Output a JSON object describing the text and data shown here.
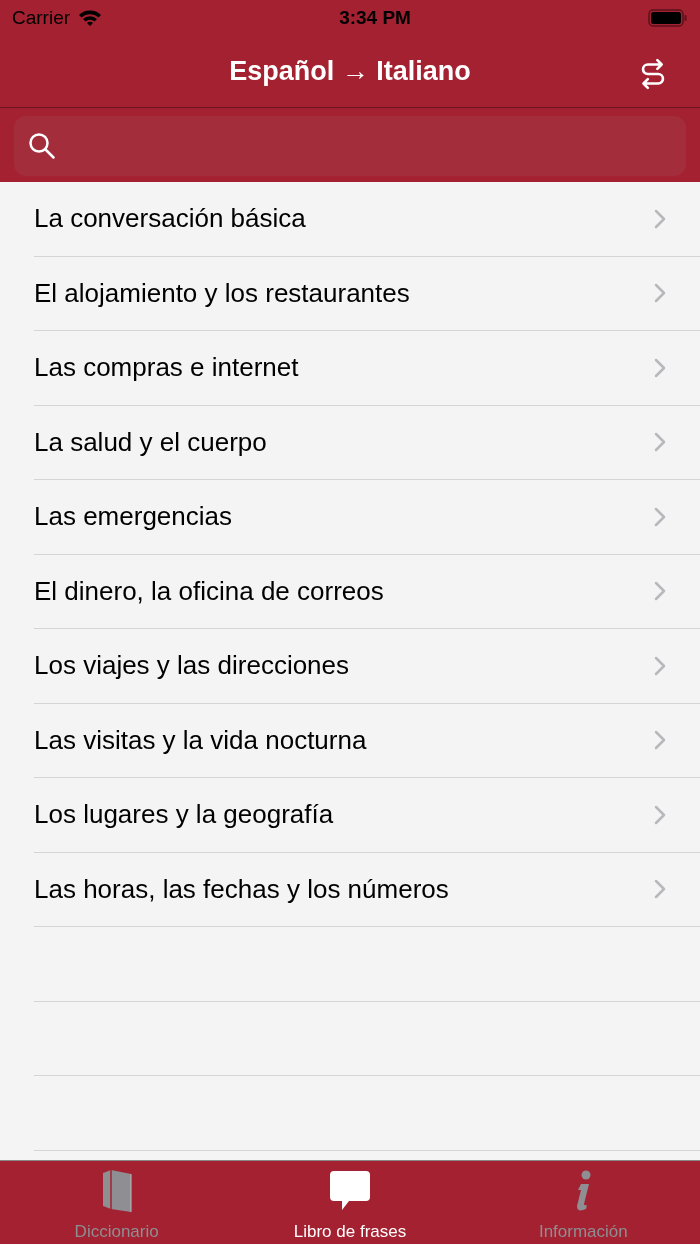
{
  "status_bar": {
    "carrier": "Carrier",
    "time": "3:34 PM"
  },
  "nav": {
    "title": "Español → Italiano"
  },
  "topics": [
    {
      "label": "La conversación básica"
    },
    {
      "label": "El alojamiento y los restaurantes"
    },
    {
      "label": "Las compras e internet"
    },
    {
      "label": "La salud y el cuerpo"
    },
    {
      "label": "Las emergencias"
    },
    {
      "label": "El dinero, la oficina de correos"
    },
    {
      "label": "Los viajes y las direcciones"
    },
    {
      "label": "Las visitas y la vida nocturna"
    },
    {
      "label": "Los lugares y la geografía"
    },
    {
      "label": "Las horas, las fechas y los números"
    }
  ],
  "tabs": [
    {
      "label": "Diccionario",
      "kind": "book",
      "selected": false
    },
    {
      "label": "Libro de frases",
      "kind": "speech",
      "selected": true
    },
    {
      "label": "Información",
      "kind": "info",
      "selected": false
    }
  ]
}
